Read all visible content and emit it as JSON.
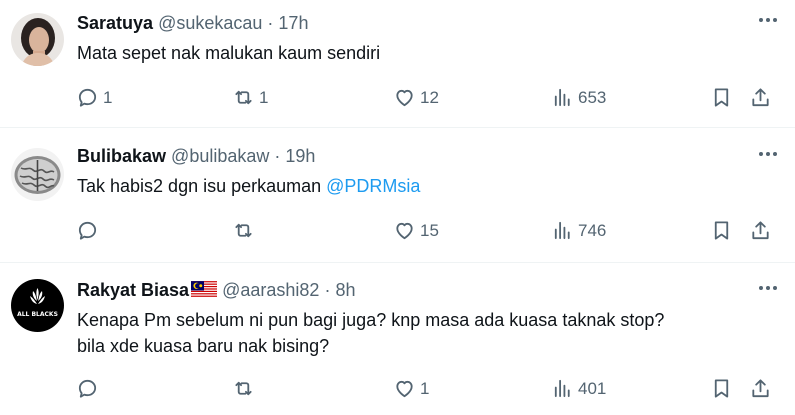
{
  "tweets": [
    {
      "name": "Saratuya",
      "handle": "@sukekacau",
      "dot": "·",
      "time": "17h",
      "text": "Mata sepet nak malukan kaum sendiri",
      "mention": "",
      "replies": "1",
      "retweets": "1",
      "likes": "12",
      "views": "653"
    },
    {
      "name": "Bulibakaw",
      "handle": "@bulibakaw",
      "dot": "·",
      "time": "19h",
      "text": "Tak habis2 dgn isu perkauman ",
      "mention": "@PDRMsia",
      "replies": "",
      "retweets": "",
      "likes": "15",
      "views": "746"
    },
    {
      "name": "Rakyat Biasa",
      "handle": "@aarashi82",
      "dot": "·",
      "time": "8h",
      "text_line1": "Kenapa Pm sebelum ni pun bagi juga? knp masa ada kuasa taknak stop?",
      "text_line2": "bila xde kuasa baru nak bising?",
      "avatar_text": "ALL BLACKS",
      "replies": "",
      "retweets": "",
      "likes": "1",
      "views": "401"
    }
  ],
  "icons": [
    "reply-icon",
    "retweet-icon",
    "like-icon",
    "views-icon",
    "bookmark-icon",
    "share-icon",
    "more-icon"
  ],
  "colors": {
    "text": "#0f1419",
    "secondary": "#536471",
    "link": "#1d9bf0",
    "divider": "#eff3f4"
  }
}
